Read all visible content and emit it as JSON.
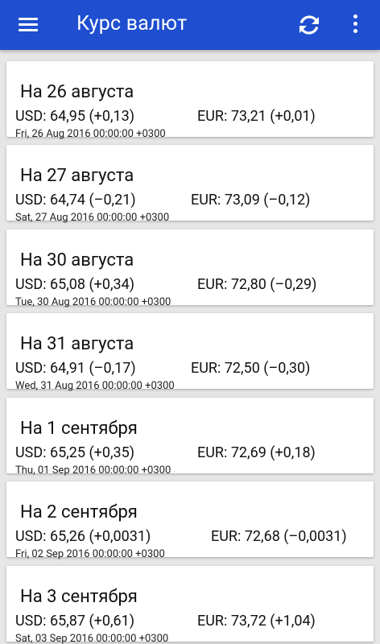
{
  "app": {
    "title": "Курс валют",
    "icons": {
      "menu": "hamburger-menu-icon",
      "refresh": "refresh-icon",
      "more": "more-vertical-icon"
    },
    "colors": {
      "appbar": "#1f4fd0",
      "background": "#e6e6e6",
      "card": "#ffffff"
    }
  },
  "rates": [
    {
      "title": "На 26 августа",
      "usd": "USD: 64,95 (+0,13)",
      "eur": "EUR: 73,21 (+0,01)",
      "timestamp": "Fri, 26 Aug 2016 00:00:00 +0300"
    },
    {
      "title": "На 27 августа",
      "usd": "USD: 64,74 (–0,21)",
      "eur": "EUR: 73,09 (–0,12)",
      "timestamp": "Sat, 27 Aug 2016 00:00:00 +0300"
    },
    {
      "title": "На 30 августа",
      "usd": "USD: 65,08 (+0,34)",
      "eur": "EUR: 72,80 (–0,29)",
      "timestamp": "Tue, 30 Aug 2016 00:00:00 +0300"
    },
    {
      "title": "На 31 августа",
      "usd": "USD: 64,91 (–0,17)",
      "eur": "EUR: 72,50 (–0,30)",
      "timestamp": "Wed, 31 Aug 2016 00:00:00 +0300"
    },
    {
      "title": "На 1 сентября",
      "usd": "USD: 65,25 (+0,35)",
      "eur": "EUR: 72,69 (+0,18)",
      "timestamp": "Thu, 01 Sep 2016 00:00:00 +0300"
    },
    {
      "title": "На 2 сентября",
      "usd": "USD: 65,26 (+0,0031)",
      "eur": "EUR: 72,68 (–0,0031)",
      "timestamp": "Fri, 02 Sep 2016 00:00:00 +0300"
    },
    {
      "title": "На 3 сентября",
      "usd": "USD: 65,87 (+0,61)",
      "eur": "EUR: 73,72 (+1,04)",
      "timestamp": "Sat, 03 Sep 2016 00:00:00 +0300"
    }
  ]
}
